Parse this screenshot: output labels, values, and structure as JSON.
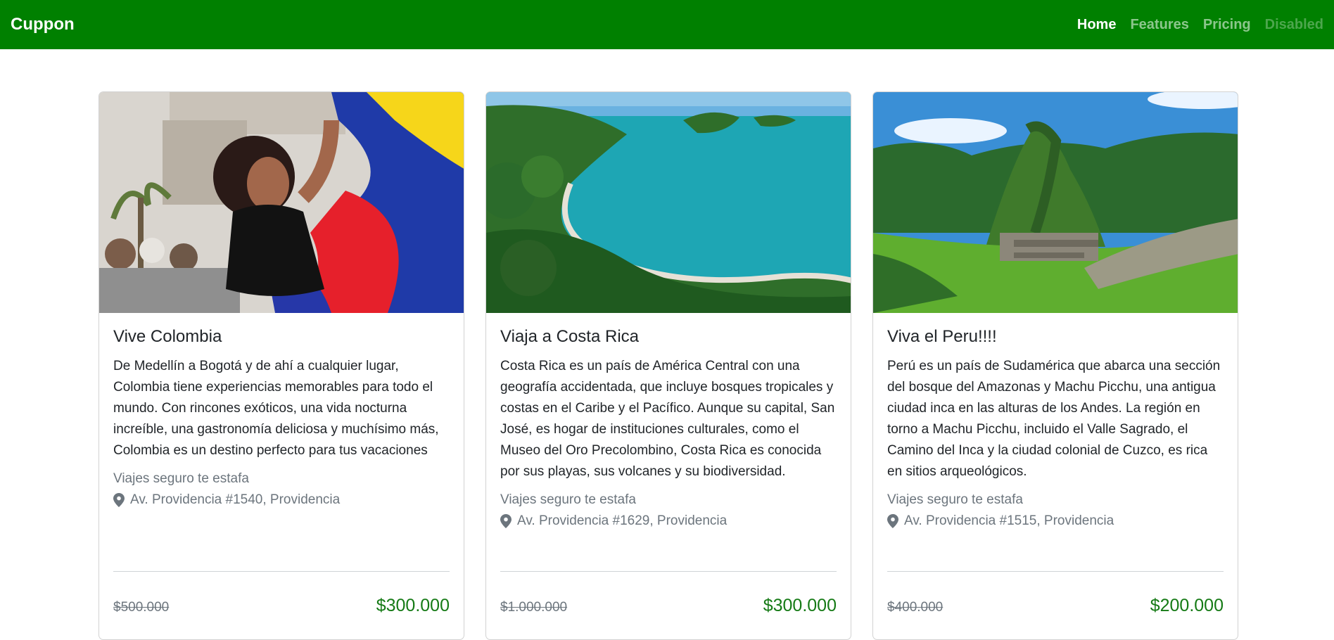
{
  "navbar": {
    "brand": "Cuppon",
    "links": [
      {
        "label": "Home",
        "state": "active"
      },
      {
        "label": "Features",
        "state": "normal"
      },
      {
        "label": "Pricing",
        "state": "normal"
      },
      {
        "label": "Disabled",
        "state": "disabled"
      }
    ],
    "color": "#008000"
  },
  "cards": [
    {
      "image": "colombia-photo",
      "title": "Vive Colombia",
      "text": "De Medellín a Bogotá y de ahí a cualquier lugar, Colombia tiene experiencias memorables para todo el mundo. Con rincones exóticos, una vida nocturna increíble, una gastronomía deliciosa y muchísimo más, Colombia es un destino perfecto para tus vacaciones",
      "subtitle": "Viajes seguro te estafa",
      "address": "Av. Providencia #1540, Providencia",
      "old_price": "$500.000",
      "new_price": "$300.000"
    },
    {
      "image": "costa-rica-photo",
      "title": "Viaja a Costa Rica",
      "text": "Costa Rica es un país de América Central con una geografía accidentada, que incluye bosques tropicales y costas en el Caribe y el Pacífico. Aunque su capital, San José, es hogar de instituciones culturales, como el Museo del Oro Precolombino, Costa Rica es conocida por sus playas, sus volcanes y su biodiversidad.",
      "subtitle": "Viajes seguro te estafa",
      "address": "Av. Providencia #1629, Providencia",
      "old_price": "$1.000.000",
      "new_price": "$300.000"
    },
    {
      "image": "peru-photo",
      "title": "Viva el Peru!!!!",
      "text": "Perú es un país de Sudamérica que abarca una sección del bosque del Amazonas y Machu Picchu, una antigua ciudad inca en las alturas de los Andes. La región en torno a Machu Picchu, incluido el Valle Sagrado, el Camino del Inca y la ciudad colonial de Cuzco, es rica en sitios arqueológicos.",
      "subtitle": "Viajes seguro te estafa",
      "address": "Av. Providencia #1515, Providencia",
      "old_price": "$400.000",
      "new_price": "$200.000"
    }
  ]
}
